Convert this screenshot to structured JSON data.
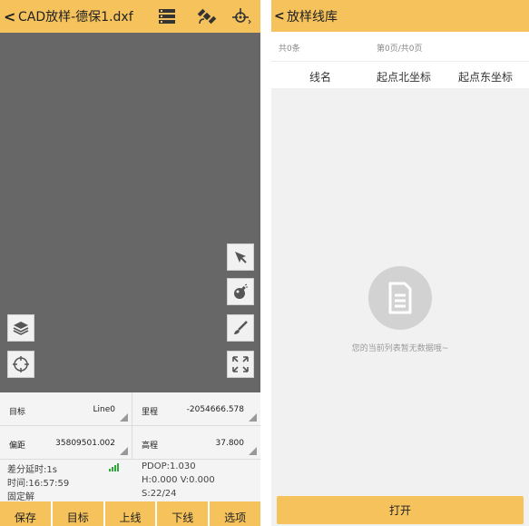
{
  "cad_screen": {
    "back_glyph": "<",
    "title": "CAD放样-德保1.dxf",
    "icons": [
      "menu-icon",
      "satellite-icon",
      "crosshair-target-icon"
    ],
    "tools_right": [
      "cursor-arrow-icon",
      "bomb-icon",
      "brush-icon",
      "fit-extent-icon"
    ],
    "tools_left": [
      "layers-icon",
      "locate-crosshair-icon"
    ],
    "fields": {
      "target": {
        "label": "目标",
        "value": "Line0"
      },
      "mileage": {
        "label": "里程",
        "value": "-2054666.578"
      },
      "offset": {
        "label": "偏距",
        "value": "35809501.002"
      },
      "elevation": {
        "label": "高程",
        "value": "37.800"
      }
    },
    "status": {
      "diff_delay": "差分延时:1s",
      "time": "时间:16:57:59",
      "solution": "固定解",
      "pdop": "PDOP:1.030",
      "hv": "H:0.000  V:0.000",
      "sats": "S:22/24",
      "signal_color": "#2eaa3a"
    },
    "buttons": [
      "保存",
      "目标",
      "上线",
      "下线",
      "选项"
    ],
    "accent": "#f5c25c"
  },
  "line_library": {
    "back_glyph": "<",
    "title": "放样线库",
    "total": "共0条",
    "page": "第0页/共0页",
    "columns": [
      "线名",
      "起点北坐标",
      "起点东坐标"
    ],
    "empty_icon": "document-icon",
    "empty_text": "您的当前列表暂无数据哦~",
    "open_button": "打开"
  }
}
